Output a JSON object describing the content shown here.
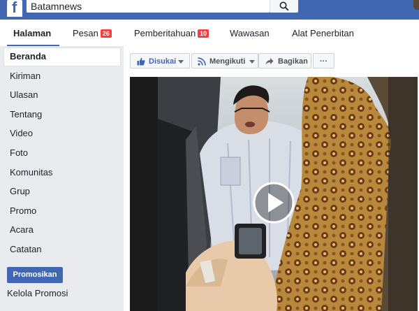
{
  "topbar": {
    "logo_letter": "f",
    "search_value": "Batamnews"
  },
  "tabs": [
    {
      "label": "Halaman"
    },
    {
      "label": "Pesan",
      "badge": "26"
    },
    {
      "label": "Pemberitahuan",
      "badge": "10"
    },
    {
      "label": "Wawasan"
    },
    {
      "label": "Alat Penerbitan"
    }
  ],
  "sidebar": {
    "items": [
      {
        "label": "Beranda"
      },
      {
        "label": "Kiriman"
      },
      {
        "label": "Ulasan"
      },
      {
        "label": "Tentang"
      },
      {
        "label": "Video"
      },
      {
        "label": "Foto"
      },
      {
        "label": "Komunitas"
      },
      {
        "label": "Grup"
      },
      {
        "label": "Promo"
      },
      {
        "label": "Acara"
      },
      {
        "label": "Catatan"
      }
    ],
    "promote_label": "Promosikan",
    "manage_promo_label": "Kelola Promosi"
  },
  "actions": {
    "liked_label": "Disukai",
    "following_label": "Mengikuti",
    "share_label": "Bagikan",
    "more_label": "···"
  },
  "colors": {
    "brand_blue": "#4267b2",
    "badge_red": "#fa3e3e",
    "page_bg": "#e9ebee"
  }
}
